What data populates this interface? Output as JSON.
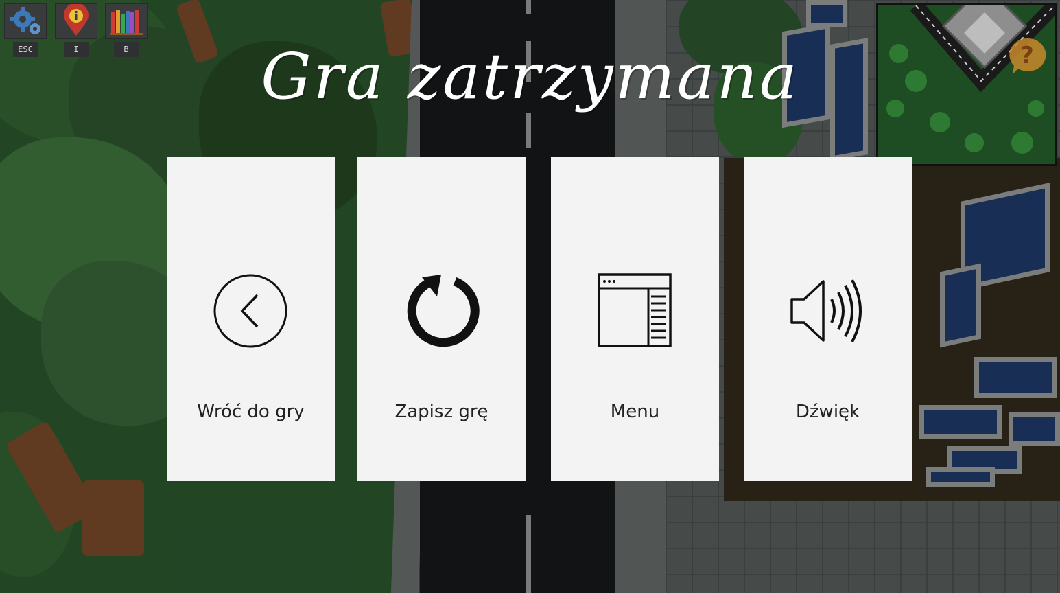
{
  "hud": {
    "settings": {
      "key": "ESC",
      "icon": "gear-icon"
    },
    "info": {
      "key": "I",
      "icon": "info-pin-icon"
    },
    "books": {
      "key": "B",
      "icon": "books-icon"
    }
  },
  "pause_menu": {
    "title": "Gra zatrzymana",
    "options": [
      {
        "label": "Wróć do gry",
        "icon": "back-arrow-circle-icon"
      },
      {
        "label": "Zapisz grę",
        "icon": "save-reload-icon"
      },
      {
        "label": "Menu",
        "icon": "menu-window-icon"
      },
      {
        "label": "Dźwięk",
        "icon": "speaker-icon"
      }
    ]
  },
  "minimap": {
    "help_icon": "question-bubble-icon"
  },
  "colors": {
    "card_bg": "#f3f3f3",
    "title": "#ffffff",
    "grass": "#274f2a",
    "road": "#141617",
    "help_accent": "#c98a2c"
  }
}
